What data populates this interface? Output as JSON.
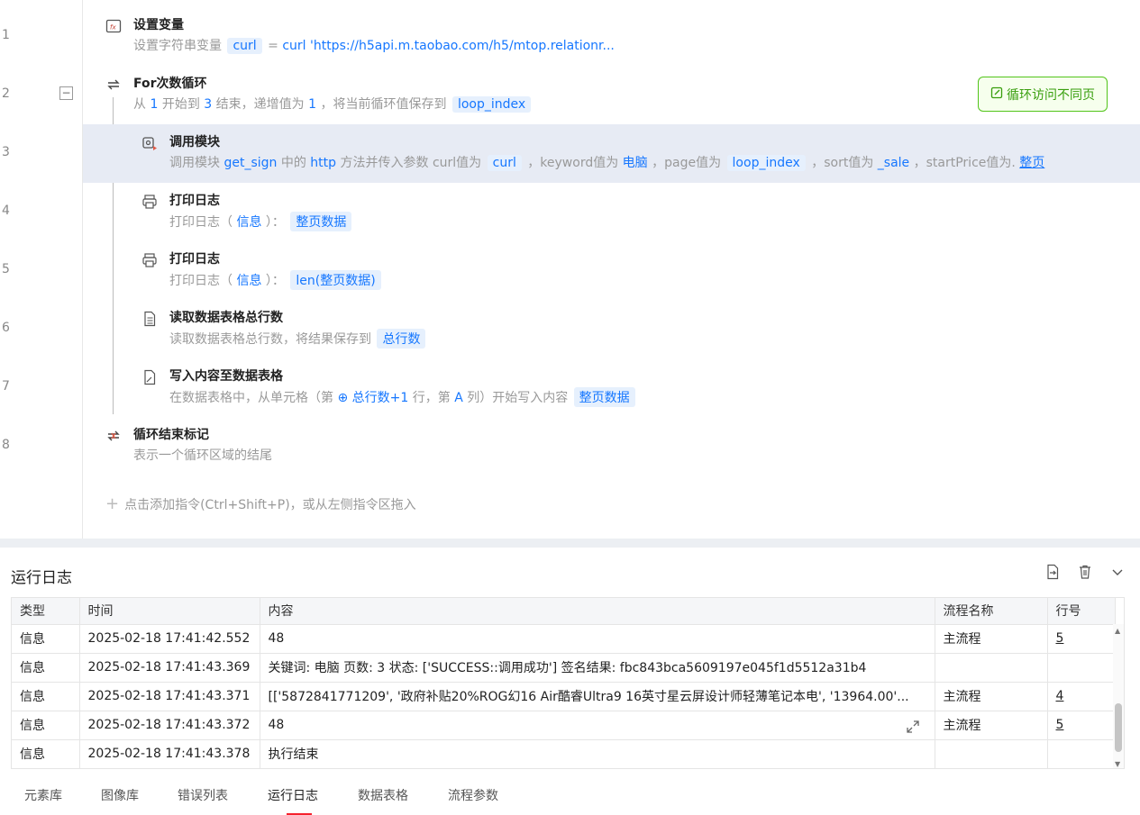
{
  "line_numbers": [
    "1",
    "2",
    "3",
    "4",
    "5",
    "6",
    "7",
    "8"
  ],
  "steps": [
    {
      "title": "设置变量",
      "desc_prefix": "设置字符串变量",
      "var": "curl",
      "eq": "=",
      "value": "curl 'https://h5api.m.taobao.com/h5/mtop.relationr...",
      "icon": "fx-variable-icon"
    },
    {
      "title": "For次数循环",
      "p1": "从",
      "n1": "1",
      "p2": "开始到",
      "n2": "3",
      "p3": "结束，递增值为",
      "n3": "1",
      "p4": "，将当前循环值保存到",
      "var": "loop_index",
      "icon": "loop-icon"
    },
    {
      "title": "调用模块",
      "p1": "调用模块",
      "mod": "get_sign",
      "p2": "中的",
      "meth": "http",
      "p3": "方法并传入参数 curl值为",
      "a1": "curl",
      "p4": "，keyword值为",
      "a2": "电脑",
      "p5": "，page值为",
      "a3": "loop_index",
      "p6": "，sort值为",
      "a4": "_sale",
      "p7": "，startPrice值为.",
      "a5": "整页",
      "icon": "module-call-icon"
    },
    {
      "title": "打印日志",
      "p1": "打印日志（",
      "level": "信息",
      "p2": "）：",
      "var": "整页数据",
      "icon": "printer-icon"
    },
    {
      "title": "打印日志",
      "p1": "打印日志（",
      "level": "信息",
      "p2": "）：",
      "var": "len(整页数据)",
      "icon": "printer-icon"
    },
    {
      "title": "读取数据表格总行数",
      "p1": "读取数据表格总行数，将结果保存到",
      "var": "总行数",
      "icon": "document-icon"
    },
    {
      "title": "写入内容至数据表格",
      "p1": "在数据表格中，从单元格（第",
      "row": "总行数+1",
      "p2": "行，第",
      "col": "A",
      "p3": "列）开始写入内容",
      "var": "整页数据",
      "icon": "write-table-icon"
    },
    {
      "title": "循环结束标记",
      "desc": "表示一个循环区域的结尾",
      "icon": "loop-end-icon"
    }
  ],
  "note_button": "循环访问不同页",
  "add_hint": "点击添加指令(Ctrl+Shift+P)，或从左侧指令区拖入",
  "log": {
    "title": "运行日志",
    "columns": [
      "类型",
      "时间",
      "内容",
      "流程名称",
      "行号"
    ],
    "rows": [
      [
        "信息",
        "2025-02-18 17:41:42.552",
        "48",
        "主流程",
        "5"
      ],
      [
        "信息",
        "2025-02-18 17:41:43.369",
        "关键词: 电脑   页数: 3   状态: ['SUCCESS::调用成功']   签名结果: fbc843bca5609197e045f1d5512a31b4",
        "",
        ""
      ],
      [
        "信息",
        "2025-02-18 17:41:43.371",
        "[['5872841771209', '政府补贴20%ROG幻16 Air酷睿Ultra9 16英寸星云屏设计师轻薄笔记本电', '13964.00'...",
        "主流程",
        "4"
      ],
      [
        "信息",
        "2025-02-18 17:41:43.372",
        "48",
        "主流程",
        "5"
      ],
      [
        "信息",
        "2025-02-18 17:41:43.378",
        "执行结束",
        "",
        ""
      ]
    ]
  },
  "tabs": [
    "元素库",
    "图像库",
    "错误列表",
    "运行日志",
    "数据表格",
    "流程参数"
  ],
  "active_tab": "运行日志"
}
